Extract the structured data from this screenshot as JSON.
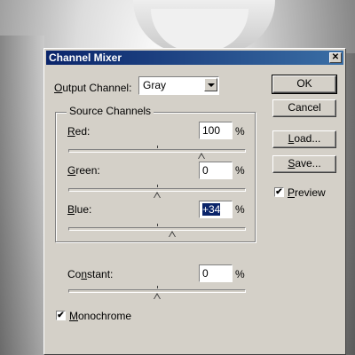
{
  "dialog": {
    "title": "Channel Mixer",
    "close_glyph": "✕"
  },
  "output": {
    "label_underline": "O",
    "label_rest": "utput Channel:",
    "value": "Gray"
  },
  "source_channels": {
    "title": "Source Channels",
    "red": {
      "underline": "R",
      "rest": "ed:",
      "value": "100",
      "percent": 100
    },
    "green": {
      "underline": "G",
      "rest": "reen:",
      "value": "0",
      "percent": 0
    },
    "blue": {
      "underline": "B",
      "rest": "lue:",
      "value": "+34",
      "percent": 34
    }
  },
  "constant": {
    "pre": "Co",
    "underline": "n",
    "rest": "stant:",
    "value": "0",
    "percent": 0
  },
  "unit": "%",
  "buttons": {
    "ok": "OK",
    "cancel": "Cancel",
    "load_underline": "L",
    "load_rest": "oad...",
    "save_underline": "S",
    "save_rest": "ave..."
  },
  "preview": {
    "underline": "P",
    "rest": "review",
    "checked": true
  },
  "monochrome": {
    "underline": "M",
    "rest": "onochrome",
    "checked": true
  },
  "check_glyph": "✔"
}
